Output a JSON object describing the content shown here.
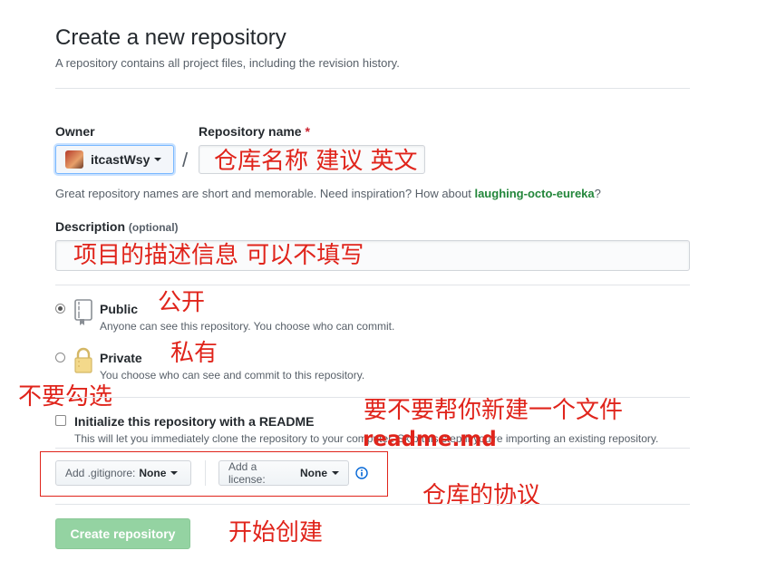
{
  "header": {
    "title": "Create a new repository",
    "subtitle": "A repository contains all project files, including the revision history."
  },
  "owner": {
    "label": "Owner",
    "value": "itcastWsy"
  },
  "repo_name": {
    "label": "Repository name",
    "required_mark": "*",
    "separator": "/",
    "value": ""
  },
  "name_hint": {
    "prefix": "Great repository names are short and memorable. Need inspiration? How about ",
    "suggestion": "laughing-octo-eureka",
    "suffix": "?"
  },
  "description": {
    "label": "Description",
    "optional": "(optional)",
    "value": ""
  },
  "visibility": {
    "public_title": "Public",
    "public_desc": "Anyone can see this repository. You choose who can commit.",
    "private_title": "Private",
    "private_desc": "You choose who can see and commit to this repository.",
    "selected": "public"
  },
  "readme": {
    "label": "Initialize this repository with a README",
    "desc": "This will let you immediately clone the repository to your computer. Skip this step if you're importing an existing repository.",
    "checked": false
  },
  "gitignore": {
    "label": "Add .gitignore:",
    "value": "None"
  },
  "license": {
    "label": "Add a license:",
    "value": "None"
  },
  "create_button": "Create repository",
  "annotations": {
    "repo_name": "仓库名称 建议 英文",
    "description": "项目的描述信息 可以不填写",
    "public": "公开",
    "private": "私有",
    "no_check": "不要勾选",
    "readme_q": "要不要帮你新建一个文件",
    "readme_md": "readme.md",
    "license": "仓库的协议",
    "create": "开始创建"
  },
  "colors": {
    "accent_green": "#94d3a2",
    "annotation_red": "#e0241b",
    "suggestion_green": "#22863a"
  }
}
